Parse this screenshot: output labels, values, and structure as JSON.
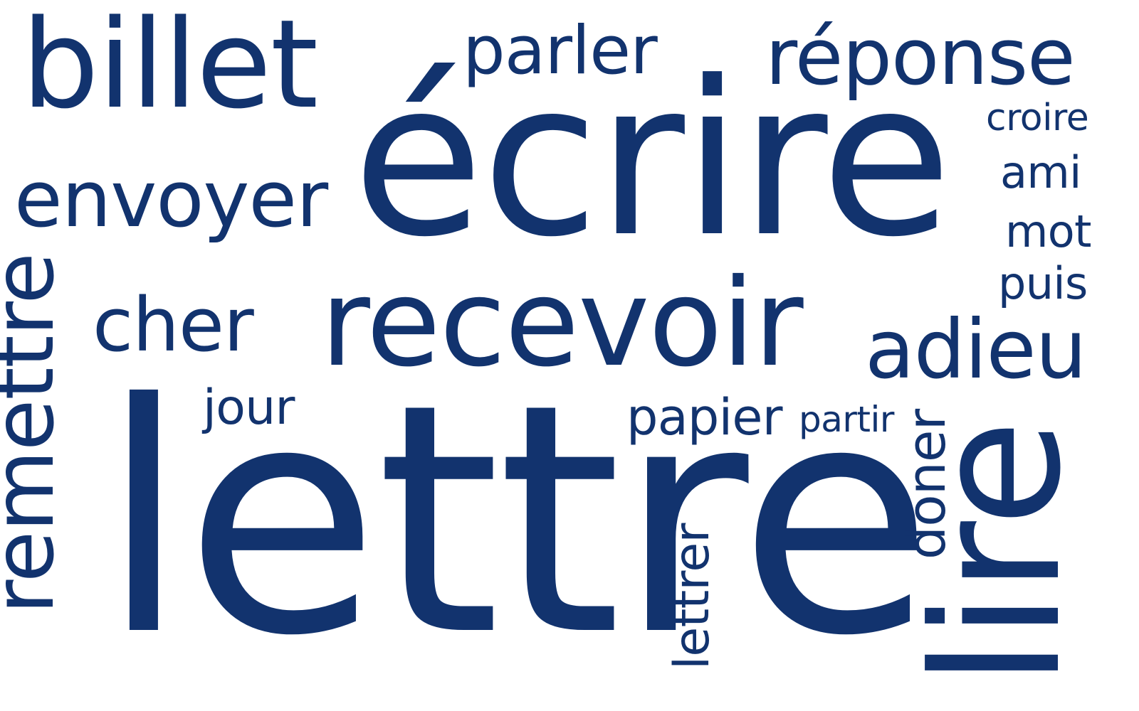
{
  "style": {
    "text_color": "#12336e",
    "background": "#ffffff"
  },
  "words": {
    "billet": "billet",
    "parler": "parler",
    "reponse": "réponse",
    "croire": "croire",
    "envoyer": "envoyer",
    "ecrire": "écrire",
    "ami": "ami",
    "mot": "mot",
    "puis": "puis",
    "remettre": "remettre",
    "cher": "cher",
    "recevoir": "recevoir",
    "adieu": "adieu",
    "jour": "jour",
    "papier": "papier",
    "partir": "partir",
    "lettre": "lettre",
    "lettrer": "lettrer",
    "doner": "doner",
    "lire": "lire"
  }
}
